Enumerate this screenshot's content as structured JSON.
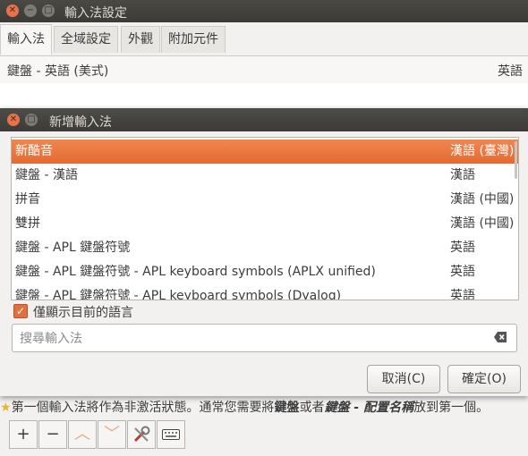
{
  "parent": {
    "title": "輸入法設定",
    "tabs": [
      "輸入法",
      "全域設定",
      "外觀",
      "附加元件"
    ],
    "current": {
      "name": "鍵盤 - 英語 (美式)",
      "lang": "英語"
    },
    "info_prefix": "第一個輸入法將作為非激活狀態。通常您需要將",
    "info_b1": "鍵盤",
    "info_mid": "或者",
    "info_b2": "鍵盤 - 配置名稱",
    "info_suffix": "放到第一個。",
    "toolbar": {
      "add": "+",
      "remove": "−",
      "up": "︿",
      "down": "﹀"
    }
  },
  "dialog": {
    "title": "新增輸入法",
    "items": [
      {
        "name": "新酷音",
        "lang": "漢語 (臺灣)"
      },
      {
        "name": "鍵盤 - 漢語",
        "lang": "漢語"
      },
      {
        "name": "拼音",
        "lang": "漢語 (中國)"
      },
      {
        "name": "雙拼",
        "lang": "漢語 (中國)"
      },
      {
        "name": "鍵盤 - APL 鍵盤符號",
        "lang": "英語"
      },
      {
        "name": "鍵盤 - APL 鍵盤符號 - APL keyboard symbols (APLX unified)",
        "lang": "英語"
      },
      {
        "name": "鍵盤 - APL 鍵盤符號 - APL keyboard symbols (Dyalog)",
        "lang": "英語"
      }
    ],
    "selected_index": 0,
    "only_current_lang": "僅顯示目前的語言",
    "search_placeholder": "搜尋輸入法",
    "cancel": "取消(C)",
    "ok": "確定(O)"
  },
  "colors": {
    "accent": "#e46a32",
    "titlebar": "#3c3b37"
  }
}
